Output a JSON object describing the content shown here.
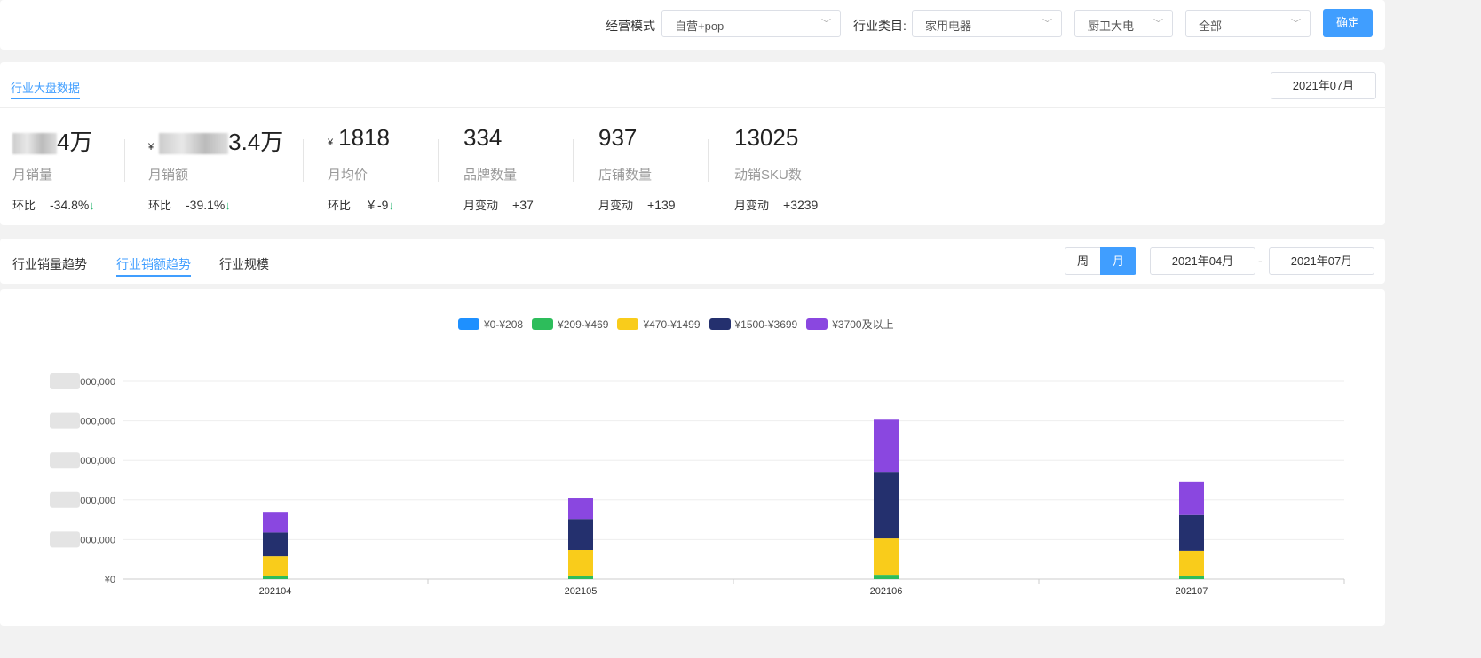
{
  "filters": {
    "mode_label": "经营模式",
    "mode_value": "自营+pop",
    "industry_label": "行业类目:",
    "industry_value": "家用电器",
    "sub_value": "厨卫大电",
    "scope_value": "全部",
    "confirm": "确定"
  },
  "overview": {
    "title": "行业大盘数据",
    "month": "2021年07月",
    "metrics": [
      {
        "value": "4万",
        "currency": "",
        "name": "月销量",
        "change_label": "环比",
        "change": "-34.8%",
        "arrow": "↓"
      },
      {
        "value": "3.4万",
        "currency": "¥",
        "name": "月销额",
        "change_label": "环比",
        "change": "-39.1%",
        "arrow": "↓"
      },
      {
        "value": "1818",
        "currency": "¥",
        "name": "月均价",
        "change_label": "环比",
        "change": "￥-9",
        "arrow": "↓"
      },
      {
        "value": "334",
        "name": "品牌数量",
        "change_label": "月变动",
        "change": "+37"
      },
      {
        "value": "937",
        "name": "店铺数量",
        "change_label": "月变动",
        "change": "+139"
      },
      {
        "value": "13025",
        "name": "动销SKU数",
        "change_label": "月变动",
        "change": "+3239"
      }
    ]
  },
  "trend": {
    "tabs": [
      "行业销量趋势",
      "行业销额趋势",
      "行业规模"
    ],
    "active_tab": 1,
    "week": "周",
    "month": "月",
    "start": "2021年04月",
    "sep": "-",
    "end": "2021年07月"
  },
  "chart_data": {
    "type": "bar",
    "stacked": true,
    "categories": [
      "202104",
      "202105",
      "202106",
      "202107"
    ],
    "y_tick_labels": [
      "¥0",
      "¥ ,000,000",
      "¥ ,000,000",
      "¥ ,000,000",
      "¥ ,000,000",
      "¥ ,000,000"
    ],
    "ylim": [
      0,
      5
    ],
    "y_unit_note": "gridline units (tick labels partially obscured)",
    "legend_position": "top",
    "series": [
      {
        "name": "¥0-¥208",
        "color": "#1e90ff",
        "values": [
          0,
          0,
          0,
          0
        ]
      },
      {
        "name": "¥209-¥469",
        "color": "#2dbd5b",
        "values": [
          0.09,
          0.09,
          0.11,
          0.09
        ]
      },
      {
        "name": "¥470-¥1499",
        "color": "#f9cc1b",
        "values": [
          0.49,
          0.65,
          0.92,
          0.63
        ]
      },
      {
        "name": "¥1500-¥3699",
        "color": "#24306e",
        "values": [
          0.6,
          0.78,
          1.68,
          0.9
        ]
      },
      {
        "name": "¥3700及以上",
        "color": "#8a47e0",
        "values": [
          0.52,
          0.52,
          1.32,
          0.85
        ]
      }
    ]
  }
}
